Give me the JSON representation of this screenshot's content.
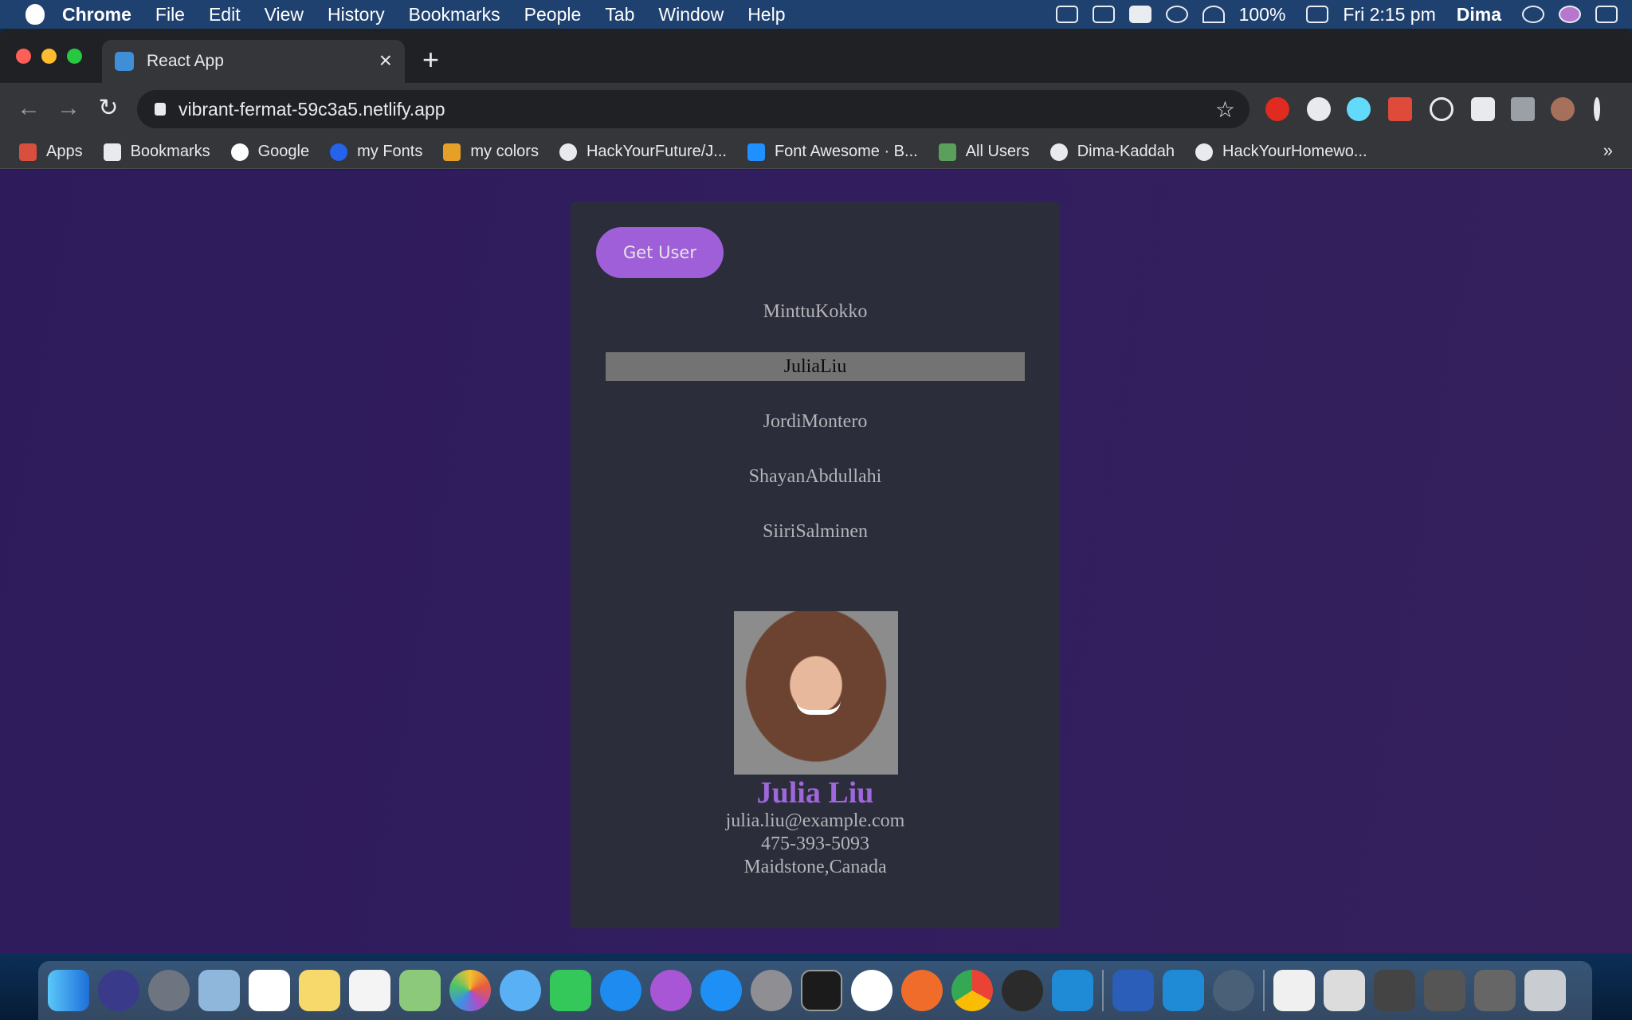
{
  "menubar": {
    "app": "Chrome",
    "items": [
      "File",
      "Edit",
      "View",
      "History",
      "Bookmarks",
      "People",
      "Tab",
      "Window",
      "Help"
    ],
    "battery": "100%",
    "time": "Fri 2:15 pm",
    "user": "Dima"
  },
  "tab": {
    "title": "React App"
  },
  "address": {
    "url": "vibrant-fermat-59c3a5.netlify.app"
  },
  "bookmarks": [
    "Apps",
    "Bookmarks",
    "Google",
    "my Fonts",
    "my colors",
    "HackYourFuture/J...",
    "Font Awesome · B...",
    "All Users",
    "Dima-Kaddah",
    "HackYourHomewo..."
  ],
  "app": {
    "button_label": "Get User",
    "users": [
      "MinttuKokko",
      "JuliaLiu",
      "JordiMontero",
      "ShayanAbdullahi",
      "SiiriSalminen"
    ],
    "selected_user": "JuliaLiu",
    "profile": {
      "name": "Julia Liu",
      "email": "julia.liu@example.com",
      "phone": "475-393-5093",
      "location": "Maidstone,Canada"
    }
  },
  "colors": {
    "accent": "#9f5fd9",
    "card": "#2b2d3a",
    "background": "#321e5e"
  }
}
